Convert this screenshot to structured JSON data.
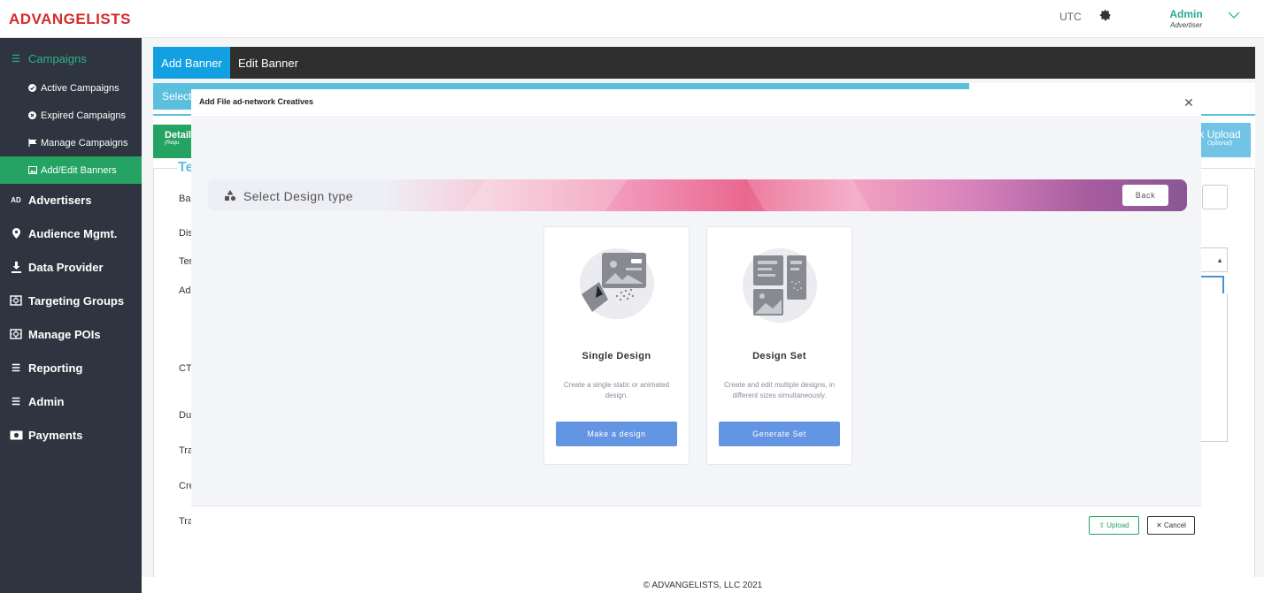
{
  "header": {
    "logo": "ADVANGELISTS",
    "timezone": "UTC",
    "user_name": "Admin",
    "user_role": "Advertiser"
  },
  "sidebar": {
    "items": [
      {
        "label": "Campaigns",
        "icon": "list-icon"
      },
      {
        "label": "Advertisers",
        "icon": "ad-icon"
      },
      {
        "label": "Audience Mgmt.",
        "icon": "map-marker-icon"
      },
      {
        "label": "Data Provider",
        "icon": "user-download-icon"
      },
      {
        "label": "Targeting Groups",
        "icon": "target-box-icon"
      },
      {
        "label": "Manage POIs",
        "icon": "target-box-icon"
      },
      {
        "label": "Reporting",
        "icon": "list-icon"
      },
      {
        "label": "Admin",
        "icon": "list-icon"
      },
      {
        "label": "Payments",
        "icon": "money-icon"
      }
    ],
    "sub_items": [
      {
        "label": "Active Campaigns",
        "icon": "check-circle-icon"
      },
      {
        "label": "Expired Campaigns",
        "icon": "times-circle-icon"
      },
      {
        "label": "Manage Campaigns",
        "icon": "flag-icon"
      },
      {
        "label": "Add/Edit Banners",
        "icon": "image-icon"
      }
    ]
  },
  "main": {
    "tabs": [
      {
        "label": "Add Banner"
      },
      {
        "label": "Edit Banner"
      }
    ],
    "select_bar_text": "Select",
    "details_tab": {
      "label": "Detail",
      "sub": "(Requ"
    },
    "bulk_tab": {
      "label": "k Upload",
      "sub": "Optional)"
    },
    "form_title": "Te",
    "form_labels": [
      "Baı",
      "Dis",
      "Ter",
      "Ad",
      "CT",
      "Du",
      "Tra",
      "Cre",
      "Tra"
    ]
  },
  "modal": {
    "title": "Add File ad-network Creatives",
    "banner_text": "Select Design type",
    "back_label": "Back",
    "cards": [
      {
        "title": "Single Design",
        "description": "Create a single static or animated design.",
        "button": "Make a design"
      },
      {
        "title": "Design Set",
        "description": "Create and edit multiple designs, in different sizes simultaneously.",
        "button": "Generate Set"
      }
    ],
    "upload_label": "Upload",
    "cancel_label": "Cancel"
  },
  "footer": {
    "copyright": "© ADVANGELISTS, LLC 2021"
  },
  "colors": {
    "brand_red": "#d62b2b",
    "accent_green": "#25a363",
    "tab_blue": "#13a0e3",
    "sidebar_bg": "#2e3540",
    "button_blue": "#6495e3"
  }
}
